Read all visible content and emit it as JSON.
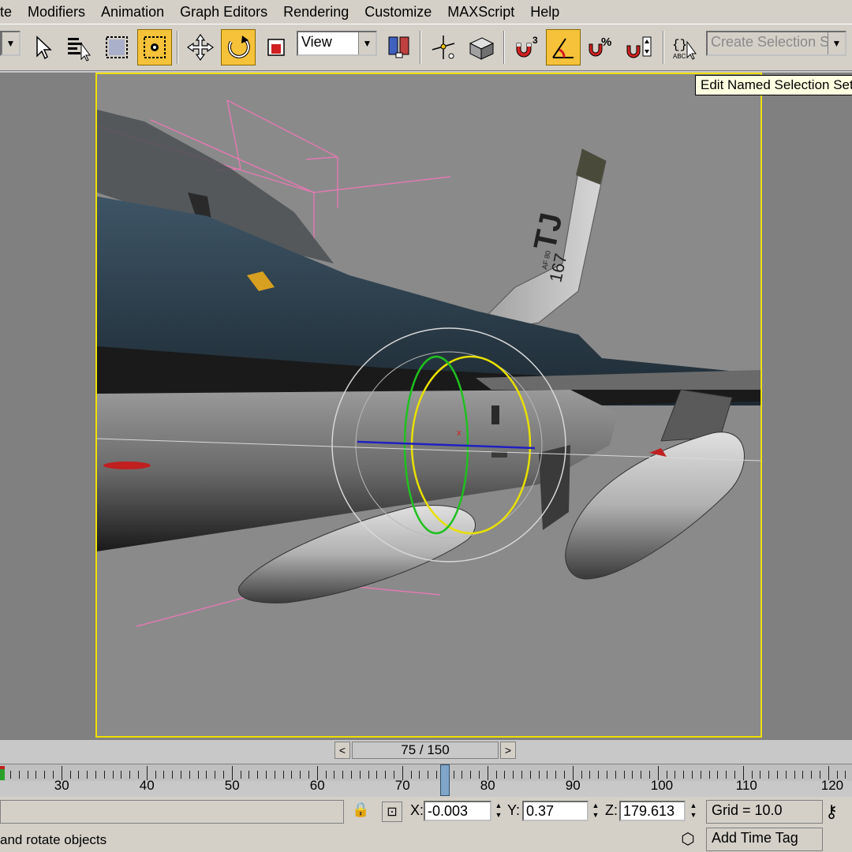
{
  "menubar": {
    "items": [
      "te",
      "Modifiers",
      "Animation",
      "Graph Editors",
      "Rendering",
      "Customize",
      "MAXScript",
      "Help"
    ]
  },
  "toolbar": {
    "icons": [
      "select-object-icon",
      "select-by-name-icon",
      "rectangular-selection-icon",
      "window-crossing-icon",
      "select-and-move-icon",
      "select-and-rotate-icon",
      "select-and-scale-icon",
      "mirror-icon",
      "align-icon",
      "snaps-toggle-icon",
      "angle-snap-icon",
      "percent-snap-icon",
      "spinner-snap-icon",
      "edit-named-selection-icon"
    ],
    "reference_coord": "View",
    "named_selection_placeholder": "Create Selection Set",
    "tooltip": "Edit Named Selection Sets",
    "active_color": "#f6c23a"
  },
  "viewport": {
    "border_color": "#f0e000",
    "tail_code": "TJ",
    "tail_number": "167",
    "tail_small": "AF 80"
  },
  "timeslider": {
    "frame_display": "75 / 150",
    "prev_label": "<",
    "next_label": ">",
    "current_frame": 75,
    "total_frames": 150
  },
  "trackbar": {
    "tick_labels": [
      "30",
      "40",
      "50",
      "60",
      "70",
      "80",
      "90",
      "100",
      "110",
      "120"
    ]
  },
  "status": {
    "x_label": "X:",
    "x_value": "-0.003",
    "y_label": "Y:",
    "y_value": "0.37",
    "z_label": "Z:",
    "z_value": "179.613",
    "grid": "Grid = 10.0",
    "prompt": "and rotate objects",
    "add_time_tag": "Add Time Tag"
  }
}
